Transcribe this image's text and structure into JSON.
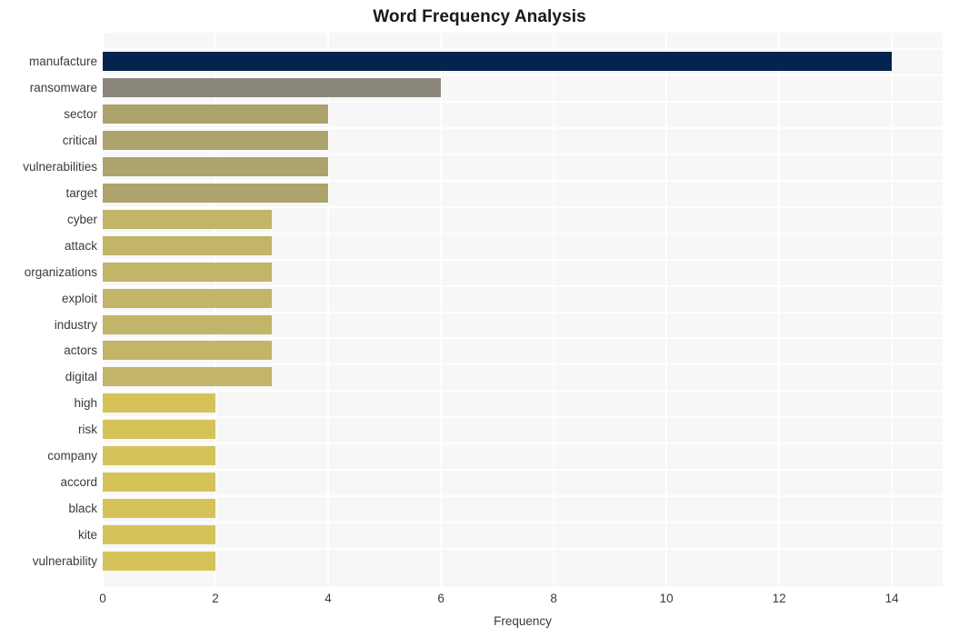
{
  "chart_data": {
    "type": "bar",
    "orientation": "horizontal",
    "title": "Word Frequency Analysis",
    "xlabel": "Frequency",
    "ylabel": "",
    "xlim": [
      0,
      14.9
    ],
    "xticks": [
      0,
      2,
      4,
      6,
      8,
      10,
      12,
      14
    ],
    "xtick_labels": [
      "0",
      "2",
      "4",
      "6",
      "8",
      "10",
      "12",
      "14"
    ],
    "grid": true,
    "legend": null,
    "categories": [
      "manufacture",
      "ransomware",
      "sector",
      "critical",
      "vulnerabilities",
      "target",
      "cyber",
      "attack",
      "organizations",
      "exploit",
      "industry",
      "actors",
      "digital",
      "high",
      "risk",
      "company",
      "accord",
      "black",
      "kite",
      "vulnerability"
    ],
    "values": [
      14,
      6,
      4,
      4,
      4,
      4,
      3,
      3,
      3,
      3,
      3,
      3,
      3,
      2,
      2,
      2,
      2,
      2,
      2,
      2
    ],
    "bar_colors": [
      "#04234d",
      "#8c877c",
      "#ada36c",
      "#ada36c",
      "#ada36c",
      "#ada36c",
      "#c2b468",
      "#c2b468",
      "#c2b468",
      "#c2b468",
      "#c2b468",
      "#c2b468",
      "#c2b468",
      "#d5c35a",
      "#d5c35a",
      "#d5c35a",
      "#d5c35a",
      "#d5c35a",
      "#d5c35a",
      "#d5c35a"
    ],
    "plot_background": "#f7f7f7",
    "gridline_color": "#ffffff",
    "text_color": "#3b3b3b",
    "title_color": "#17191c"
  }
}
